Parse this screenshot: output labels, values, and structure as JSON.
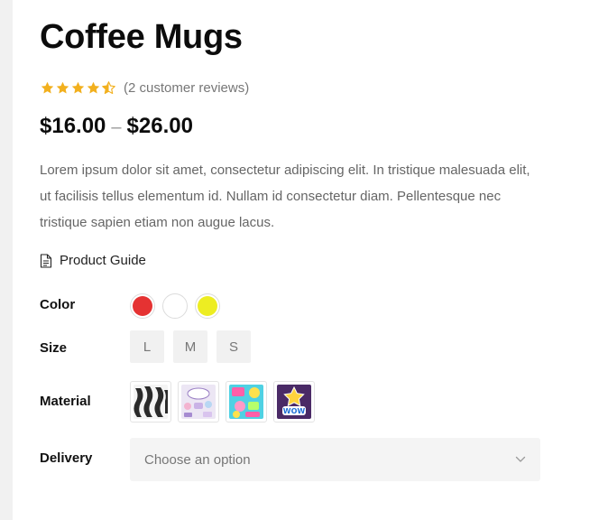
{
  "product": {
    "title": "Coffee Mugs",
    "rating": 4.5,
    "rating_max": 5,
    "reviews_text": "(2 customer reviews)",
    "price_min": "$16.00",
    "price_sep": "–",
    "price_max": "$26.00",
    "description": "Lorem ipsum dolor sit amet, consectetur adipiscing elit. In tristique malesuada elit, ut facilisis tellus elementum id. Nullam id consectetur diam. Pellentesque nec tristique sapien etiam non augue lacus.",
    "guide_label": "Product Guide"
  },
  "attributes": {
    "color": {
      "label": "Color",
      "options": [
        {
          "name": "red",
          "hex": "#e53232"
        },
        {
          "name": "white",
          "hex": "#ffffff"
        },
        {
          "name": "yellow",
          "hex": "#eded22"
        }
      ]
    },
    "size": {
      "label": "Size",
      "options": [
        "L",
        "M",
        "S"
      ]
    },
    "material": {
      "label": "Material",
      "options": [
        "zebra-stripes",
        "pastel-stickers",
        "colorful-stickers",
        "wow-star"
      ]
    },
    "delivery": {
      "label": "Delivery",
      "placeholder": "Choose an option"
    }
  },
  "colors": {
    "star": "#f2b01e",
    "text_muted": "#666666"
  }
}
